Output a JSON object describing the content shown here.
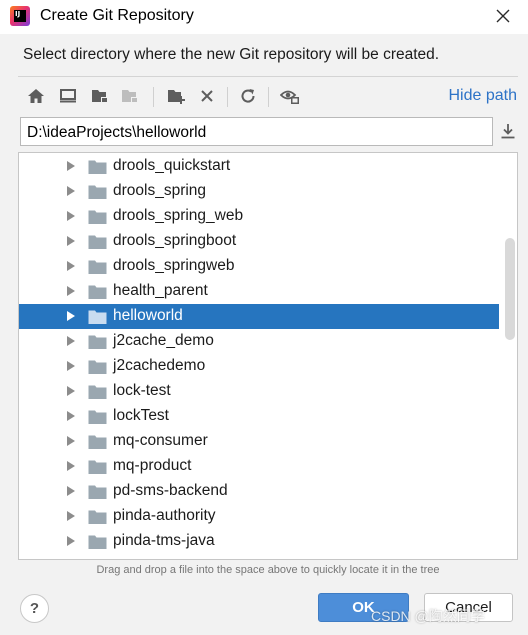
{
  "window": {
    "title": "Create Git Repository",
    "icon": "intellij-idea-icon"
  },
  "prompt": "Select directory where the new Git repository will be created.",
  "toolbar": {
    "buttons": [
      {
        "name": "home-directory-icon"
      },
      {
        "name": "desktop-icon"
      },
      {
        "name": "project-folder-icon"
      },
      {
        "name": "module-folder-icon"
      },
      {
        "name": "new-folder-icon"
      },
      {
        "name": "delete-icon"
      },
      {
        "name": "refresh-icon"
      },
      {
        "name": "show-hidden-files-icon"
      }
    ],
    "hide_path_label": "Hide path"
  },
  "path_field": {
    "value": "D:\\ideaProjects\\helloworld"
  },
  "tree": {
    "items": [
      {
        "label": "drools_quickstart",
        "selected": false
      },
      {
        "label": "drools_spring",
        "selected": false
      },
      {
        "label": "drools_spring_web",
        "selected": false
      },
      {
        "label": "drools_springboot",
        "selected": false
      },
      {
        "label": "drools_springweb",
        "selected": false
      },
      {
        "label": "health_parent",
        "selected": false
      },
      {
        "label": "helloworld",
        "selected": true
      },
      {
        "label": "j2cache_demo",
        "selected": false
      },
      {
        "label": "j2cachedemo",
        "selected": false
      },
      {
        "label": "lock-test",
        "selected": false
      },
      {
        "label": "lockTest",
        "selected": false
      },
      {
        "label": "mq-consumer",
        "selected": false
      },
      {
        "label": "mq-product",
        "selected": false
      },
      {
        "label": "pd-sms-backend",
        "selected": false
      },
      {
        "label": "pinda-authority",
        "selected": false
      },
      {
        "label": "pinda-tms-java",
        "selected": false
      }
    ]
  },
  "hint": "Drag and drop a file into the space above to quickly locate it in the tree",
  "buttons": {
    "help": "?",
    "ok": "OK",
    "cancel": "Cancel"
  },
  "watermark": "CSDN @陶然同学",
  "colors": {
    "accent": "#2675bf",
    "link": "#2d73c7",
    "ok_button": "#4d8ed9",
    "folder": "#9aa7b0"
  }
}
